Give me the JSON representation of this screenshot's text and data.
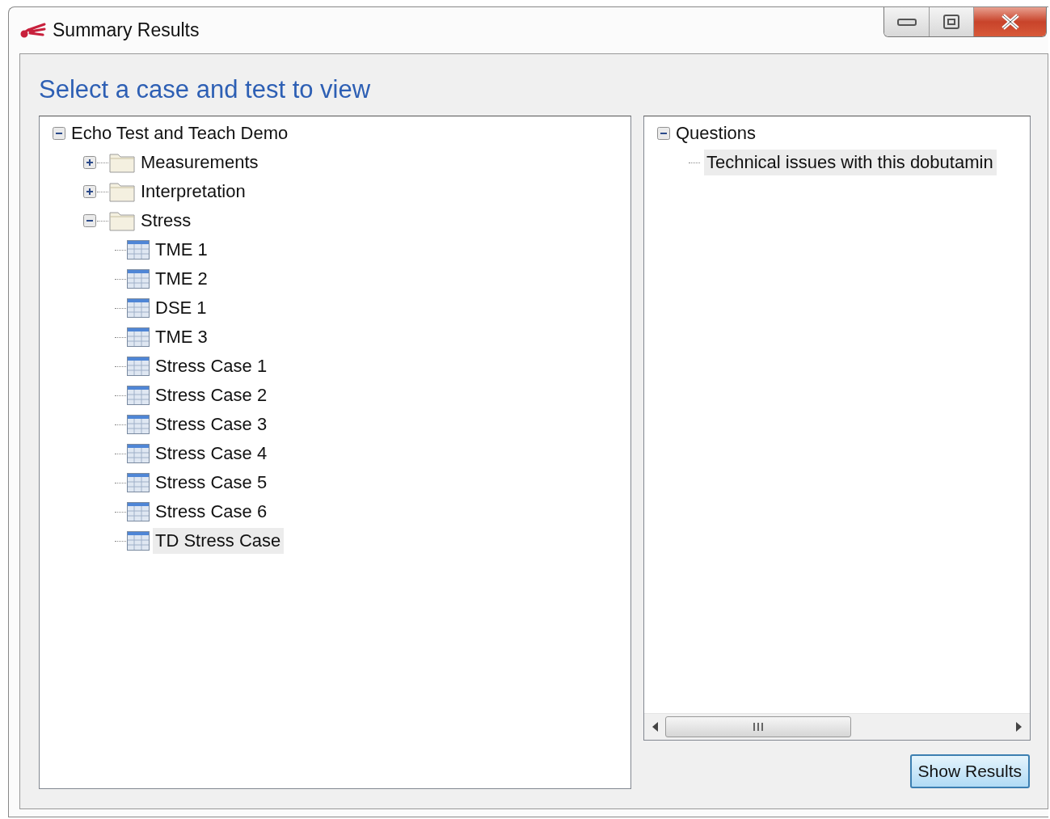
{
  "window": {
    "title": "Summary Results"
  },
  "heading": "Select a case and test to view",
  "case_tree": [
    {
      "label": "Echo Test and Teach Demo",
      "kind": "root",
      "expanded": true,
      "selected": false,
      "children": [
        {
          "label": "Measurements",
          "kind": "folder",
          "expanded": false,
          "selected": false
        },
        {
          "label": "Interpretation",
          "kind": "folder",
          "expanded": false,
          "selected": false
        },
        {
          "label": "Stress",
          "kind": "folder",
          "expanded": true,
          "selected": false,
          "children": [
            {
              "label": "TME 1",
              "kind": "test",
              "selected": false
            },
            {
              "label": "TME 2",
              "kind": "test",
              "selected": false
            },
            {
              "label": "DSE 1",
              "kind": "test",
              "selected": false
            },
            {
              "label": "TME 3",
              "kind": "test",
              "selected": false
            },
            {
              "label": "Stress Case 1",
              "kind": "test",
              "selected": false
            },
            {
              "label": "Stress Case 2",
              "kind": "test",
              "selected": false
            },
            {
              "label": "Stress Case 3",
              "kind": "test",
              "selected": false
            },
            {
              "label": "Stress Case 4",
              "kind": "test",
              "selected": false
            },
            {
              "label": "Stress Case 5",
              "kind": "test",
              "selected": false
            },
            {
              "label": "Stress Case 6",
              "kind": "test",
              "selected": false
            },
            {
              "label": "TD Stress Case",
              "kind": "test",
              "selected": true
            }
          ]
        }
      ]
    }
  ],
  "question_tree": [
    {
      "label": "Questions",
      "kind": "root",
      "expanded": true,
      "selected": false,
      "children": [
        {
          "label": "Technical issues with this dobutamin",
          "selected": true
        }
      ]
    }
  ],
  "buttons": [
    {
      "label": "Show Results"
    }
  ]
}
